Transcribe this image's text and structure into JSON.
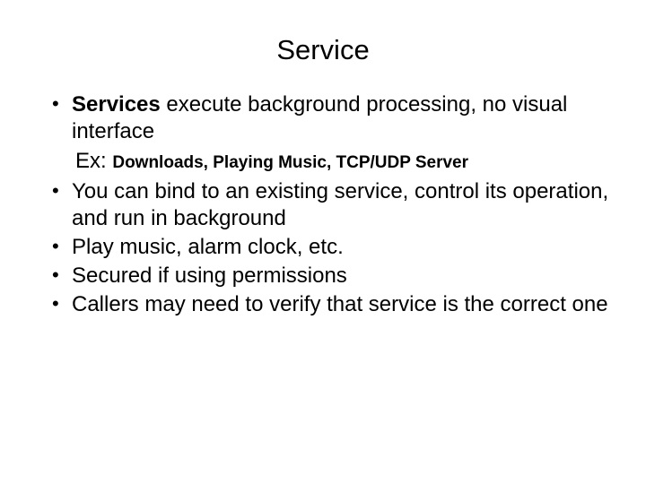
{
  "title": "Service",
  "bullets": {
    "b1_bold": "Services",
    "b1_rest": " execute background processing, no visual interface",
    "example_prefix": "Ex: ",
    "example_detail": "Downloads, Playing Music, TCP/UDP Server",
    "b2": "You can bind to an existing service, control its operation, and  run in background",
    "b3": "Play music, alarm clock, etc.",
    "b4": "Secured if using permissions",
    "b5": "Callers may need to verify that service is the correct one"
  }
}
